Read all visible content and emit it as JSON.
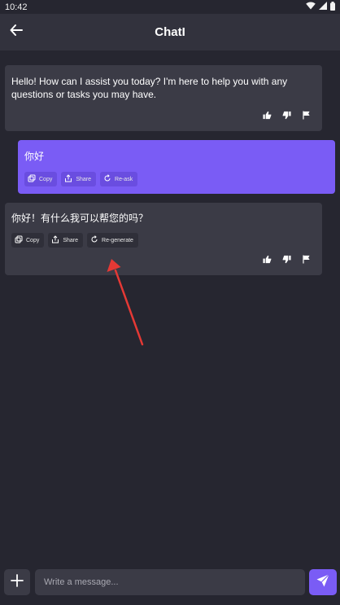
{
  "status_bar": {
    "time": "10:42"
  },
  "app_bar": {
    "title": "ChatI"
  },
  "messages": [
    {
      "role": "bot",
      "text": "Hello! How can I assist you today? I'm here to help you with any questions or tasks you may have."
    },
    {
      "role": "user",
      "text": "你好",
      "actions": {
        "copy": "Copy",
        "share": "Share",
        "reask": "Re-ask"
      }
    },
    {
      "role": "bot",
      "text": "你好！有什么我可以帮您的吗？",
      "actions": {
        "copy": "Copy",
        "share": "Share",
        "regenerate": "Re-generate"
      }
    }
  ],
  "composer": {
    "placeholder": "Write a message..."
  },
  "colors": {
    "accent": "#7a5cf5",
    "background": "#262630",
    "bubble": "#3b3b46",
    "annotation_arrow": "#e53935"
  },
  "icons": [
    "back-arrow-icon",
    "wifi-icon",
    "signal-icon",
    "battery-icon",
    "copy-icon",
    "share-icon",
    "refresh-icon",
    "thumb-up-icon",
    "thumb-down-icon",
    "flag-icon",
    "plus-icon",
    "send-icon"
  ]
}
